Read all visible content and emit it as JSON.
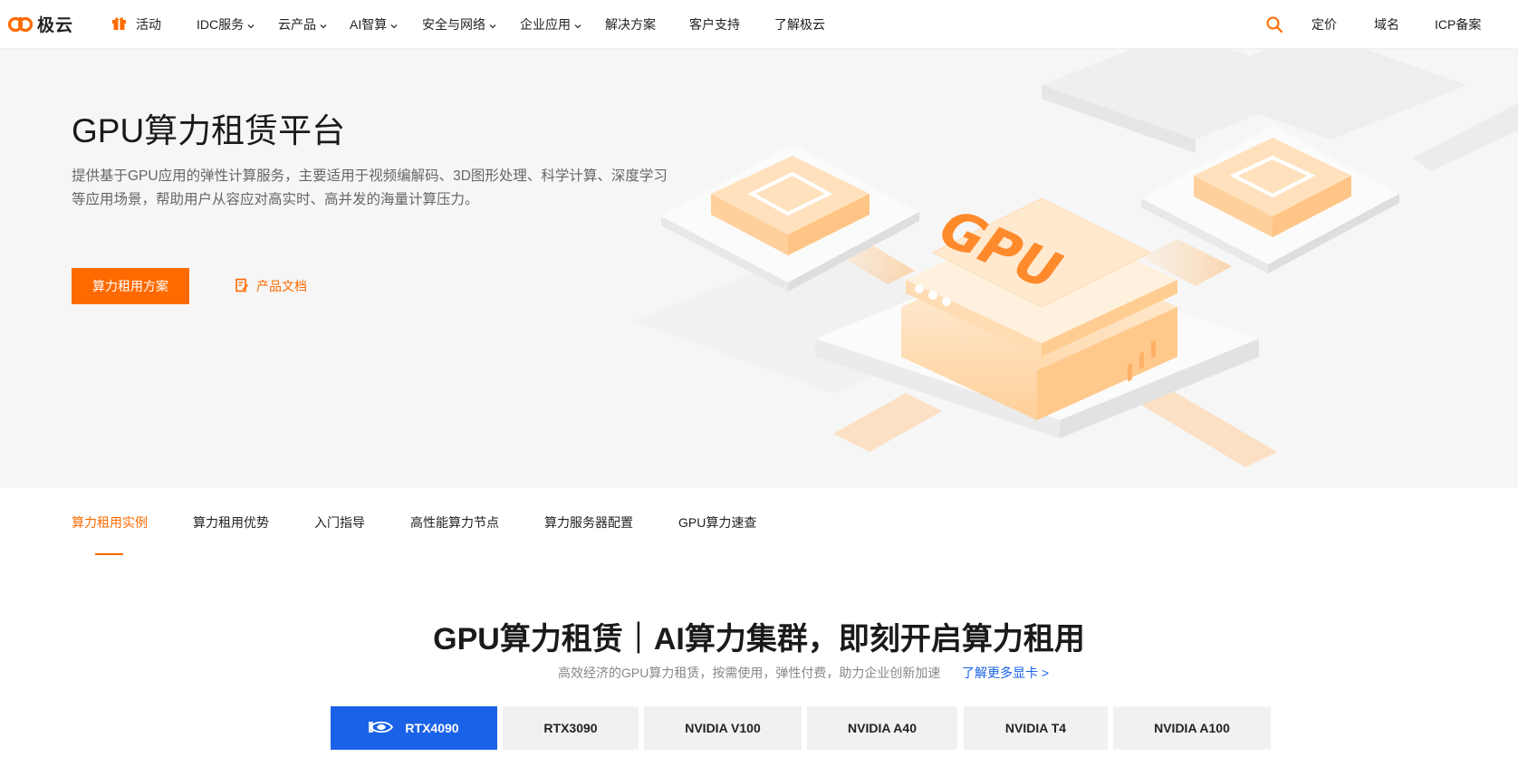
{
  "brand": {
    "name": "极云",
    "accent": "#ff6a00",
    "link_color": "#1a62e8"
  },
  "nav": {
    "activity": "活动",
    "items": [
      {
        "label": "IDC服务",
        "has_dropdown": true
      },
      {
        "label": "云产品",
        "has_dropdown": true
      },
      {
        "label": "AI智算",
        "has_dropdown": true
      },
      {
        "label": "安全与网络",
        "has_dropdown": true
      },
      {
        "label": "企业应用",
        "has_dropdown": true
      },
      {
        "label": "解决方案",
        "has_dropdown": false
      },
      {
        "label": "客户支持",
        "has_dropdown": false
      },
      {
        "label": "了解极云",
        "has_dropdown": false
      }
    ],
    "right": [
      "定价",
      "域名",
      "ICP备案"
    ]
  },
  "hero": {
    "title": "GPU算力租赁平台",
    "desc_line1": "提供基于GPU应用的弹性计算服务，主要适用于视频编解码、3D图形处理、科学计算、深度学习",
    "desc_line2": "等应用场景，帮助用户从容应对高实时、高并发的海量计算压力。",
    "primary_button": "算力租用方案",
    "doc_link": "产品文档",
    "art_label": "GPU"
  },
  "subtabs": {
    "items": [
      "算力租用实例",
      "算力租用优势",
      "入门指导",
      "高性能算力节点",
      "算力服务器配置",
      "GPU算力速查"
    ],
    "active_index": 0
  },
  "section": {
    "title": "GPU算力租赁｜AI算力集群，即刻开启算力租用",
    "subtitle": "高效经济的GPU算力租赁，按需使用，弹性付费，助力企业创新加速",
    "more_link": "了解更多显卡 >"
  },
  "gpu_tabs": {
    "items": [
      "RTX4090",
      "RTX3090",
      "NVIDIA V100",
      "NVIDIA A40",
      "NVIDIA T4",
      "NVIDIA A100"
    ],
    "active_index": 0
  }
}
